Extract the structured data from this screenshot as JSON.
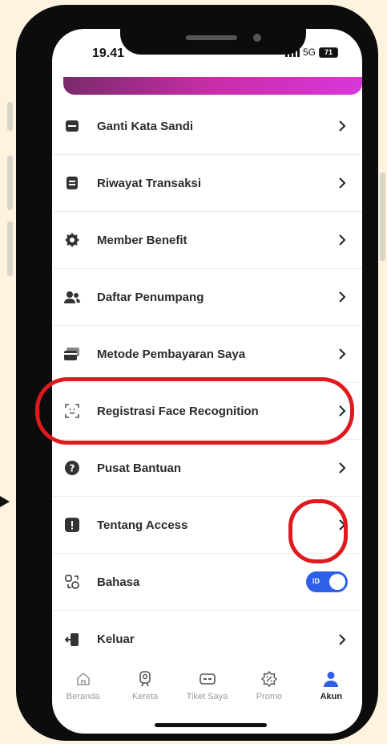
{
  "status_bar": {
    "time": "19.41",
    "network": "5G",
    "battery": "71"
  },
  "menu": {
    "items": [
      {
        "label": "Ganti Kata Sandi",
        "icon": "key-icon"
      },
      {
        "label": "Riwayat Transaksi",
        "icon": "document-icon"
      },
      {
        "label": "Member Benefit",
        "icon": "badge-icon"
      },
      {
        "label": "Daftar Penumpang",
        "icon": "people-icon"
      },
      {
        "label": "Metode Pembayaran Saya",
        "icon": "card-icon"
      },
      {
        "label": "Registrasi Face Recognition",
        "icon": "face-scan-icon"
      },
      {
        "label": "Pusat Bantuan",
        "icon": "help-icon"
      },
      {
        "label": "Tentang Access",
        "icon": "info-icon"
      },
      {
        "label": "Bahasa",
        "icon": "language-icon"
      },
      {
        "label": "Keluar",
        "icon": "logout-icon"
      }
    ],
    "language_toggle": "ID"
  },
  "tabbar": {
    "items": [
      {
        "label": "Beranda",
        "icon": "home-icon"
      },
      {
        "label": "Kereta",
        "icon": "train-icon"
      },
      {
        "label": "Tiket Saya",
        "icon": "ticket-icon"
      },
      {
        "label": "Promo",
        "icon": "promo-icon"
      },
      {
        "label": "Akun",
        "icon": "account-icon"
      }
    ],
    "active": "Akun"
  },
  "colors": {
    "accent": "#2f5fe8",
    "highlight": "#e0191f",
    "banner": "#c72ea8"
  }
}
